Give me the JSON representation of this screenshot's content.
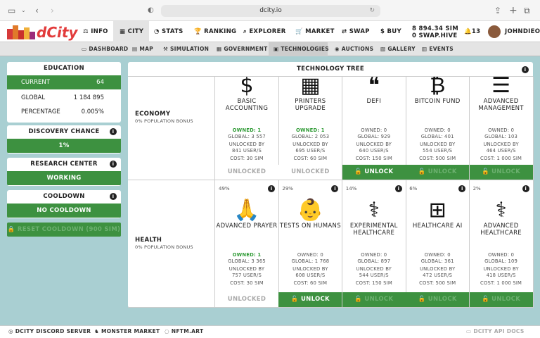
{
  "browser": {
    "url": "dcity.io"
  },
  "nav": {
    "logo": "dCity",
    "items": [
      {
        "label": "INFO",
        "icon": "⚖"
      },
      {
        "label": "CITY",
        "icon": "▦"
      },
      {
        "label": "STATS",
        "icon": "◔"
      },
      {
        "label": "RANKING",
        "icon": "🏆"
      },
      {
        "label": "EXPLORER",
        "icon": "⌕"
      },
      {
        "label": "MARKET",
        "icon": "🛒"
      },
      {
        "label": "SWAP",
        "icon": "⇄"
      },
      {
        "label": "BUY",
        "icon": "$"
      }
    ],
    "balance_sim": "8 894.34 SIM",
    "balance_hive": "0 SWAP.HIVE",
    "notifications": "13",
    "username": "JOHNDIEO"
  },
  "subnav": {
    "items": [
      "DASHBOARD",
      "MAP",
      "SIMULATION",
      "GOVERNMENT",
      "TECHNOLOGIES",
      "AUCTIONS",
      "GALLERY",
      "EVENTS"
    ]
  },
  "education": {
    "title": "EDUCATION",
    "current_label": "CURRENT",
    "current_value": "64",
    "global_label": "GLOBAL",
    "global_value": "1 184 895",
    "percentage_label": "PERCENTAGE",
    "percentage_value": "0.005%"
  },
  "discovery": {
    "title": "DISCOVERY CHANCE",
    "value": "1%"
  },
  "research": {
    "title": "RESEARCH CENTER",
    "value": "WORKING"
  },
  "cooldown": {
    "title": "COOLDOWN",
    "value": "NO COOLDOWN",
    "reset_label": "RESET COOLDOWN (900 SIM)"
  },
  "tree": {
    "title": "TECHNOLOGY TREE",
    "rows": [
      {
        "name": "ECONOMY",
        "bonus": "0% POPULATION BONUS",
        "cells": [
          {
            "pct": "",
            "icon": "$",
            "name": "BASIC ACCOUNTING",
            "owned": "OWNED: 1",
            "global": "GLOBAL: 3 557",
            "unlocked": "UNLOCKED BY",
            "users": "841 USER/S",
            "cost": "COST: 30 SIM",
            "action": "UNLOCKED",
            "state": "locked",
            "owned_green": true
          },
          {
            "pct": "",
            "icon": "▦",
            "name": "PRINTERS UPGRADE",
            "owned": "OWNED: 1",
            "global": "GLOBAL: 2 053",
            "unlocked": "UNLOCKED BY",
            "users": "695 USER/S",
            "cost": "COST: 60 SIM",
            "action": "UNLOCKED",
            "state": "locked",
            "owned_green": true
          },
          {
            "pct": "",
            "icon": "❝",
            "name": "DEFI",
            "owned": "OWNED: 0",
            "global": "GLOBAL: 929",
            "unlocked": "UNLOCKED BY",
            "users": "640 USER/S",
            "cost": "COST: 150 SIM",
            "action": "UNLOCK",
            "state": "unlock",
            "owned_green": false
          },
          {
            "pct": "",
            "icon": "₿",
            "name": "BITCOIN FUND",
            "owned": "OWNED: 0",
            "global": "GLOBAL: 401",
            "unlocked": "UNLOCKED BY",
            "users": "554 USER/S",
            "cost": "COST: 500 SIM",
            "action": "UNLOCK",
            "state": "disabled",
            "owned_green": false
          },
          {
            "pct": "",
            "icon": "☰",
            "name": "ADVANCED MANAGEMENT",
            "owned": "OWNED: 0",
            "global": "GLOBAL: 103",
            "unlocked": "UNLOCKED BY",
            "users": "464 USER/S",
            "cost": "COST: 1 000 SIM",
            "action": "UNLOCK",
            "state": "disabled",
            "owned_green": false
          }
        ]
      },
      {
        "name": "HEALTH",
        "bonus": "0% POPULATION BONUS",
        "cells": [
          {
            "pct": "49%",
            "icon": "🙏",
            "name": "ADVANCED PRAYER",
            "owned": "OWNED: 1",
            "global": "GLOBAL: 3 365",
            "unlocked": "UNLOCKED BY",
            "users": "757 USER/S",
            "cost": "COST: 30 SIM",
            "action": "UNLOCKED",
            "state": "locked",
            "owned_green": true
          },
          {
            "pct": "29%",
            "icon": "👶",
            "name": "TESTS ON HUMANS",
            "owned": "OWNED: 0",
            "global": "GLOBAL: 1 768",
            "unlocked": "UNLOCKED BY",
            "users": "608 USER/S",
            "cost": "COST: 60 SIM",
            "action": "UNLOCK",
            "state": "unlock",
            "owned_green": false
          },
          {
            "pct": "14%",
            "icon": "⚕",
            "name": "EXPERIMENTAL HEALTHCARE",
            "owned": "OWNED: 0",
            "global": "GLOBAL: 897",
            "unlocked": "UNLOCKED BY",
            "users": "544 USER/S",
            "cost": "COST: 150 SIM",
            "action": "UNLOCK",
            "state": "disabled",
            "owned_green": false
          },
          {
            "pct": "6%",
            "icon": "⊞",
            "name": "HEALTHCARE AI",
            "owned": "OWNED: 0",
            "global": "GLOBAL: 361",
            "unlocked": "UNLOCKED BY",
            "users": "472 USER/S",
            "cost": "COST: 500 SIM",
            "action": "UNLOCK",
            "state": "disabled",
            "owned_green": false
          },
          {
            "pct": "2%",
            "icon": "⚕",
            "name": "ADVANCED HEALTHCARE",
            "owned": "OWNED: 0",
            "global": "GLOBAL: 109",
            "unlocked": "UNLOCKED BY",
            "users": "418 USER/S",
            "cost": "COST: 1 000 SIM",
            "action": "UNLOCK",
            "state": "disabled",
            "owned_green": false
          }
        ]
      }
    ]
  },
  "footer": {
    "links": [
      "DCITY DISCORD SERVER",
      "MONSTER MARKET",
      "NFTM.ART"
    ],
    "api": "DCITY API DOCS"
  }
}
